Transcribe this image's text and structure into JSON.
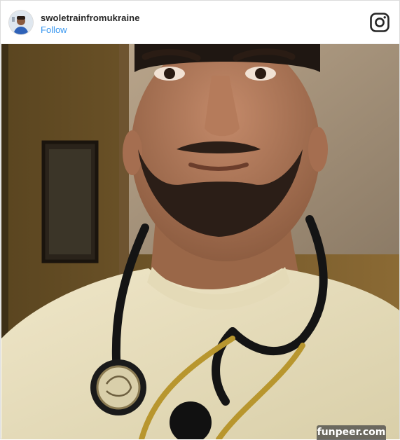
{
  "post": {
    "username": "swoletrainfromukraine",
    "follow_label": "Follow"
  },
  "icons": {
    "brand": "instagram-icon",
    "avatar": "avatar"
  },
  "colors": {
    "follow": "#3897f0",
    "username": "#262626"
  },
  "watermark": {
    "text": "funpeer.com"
  }
}
